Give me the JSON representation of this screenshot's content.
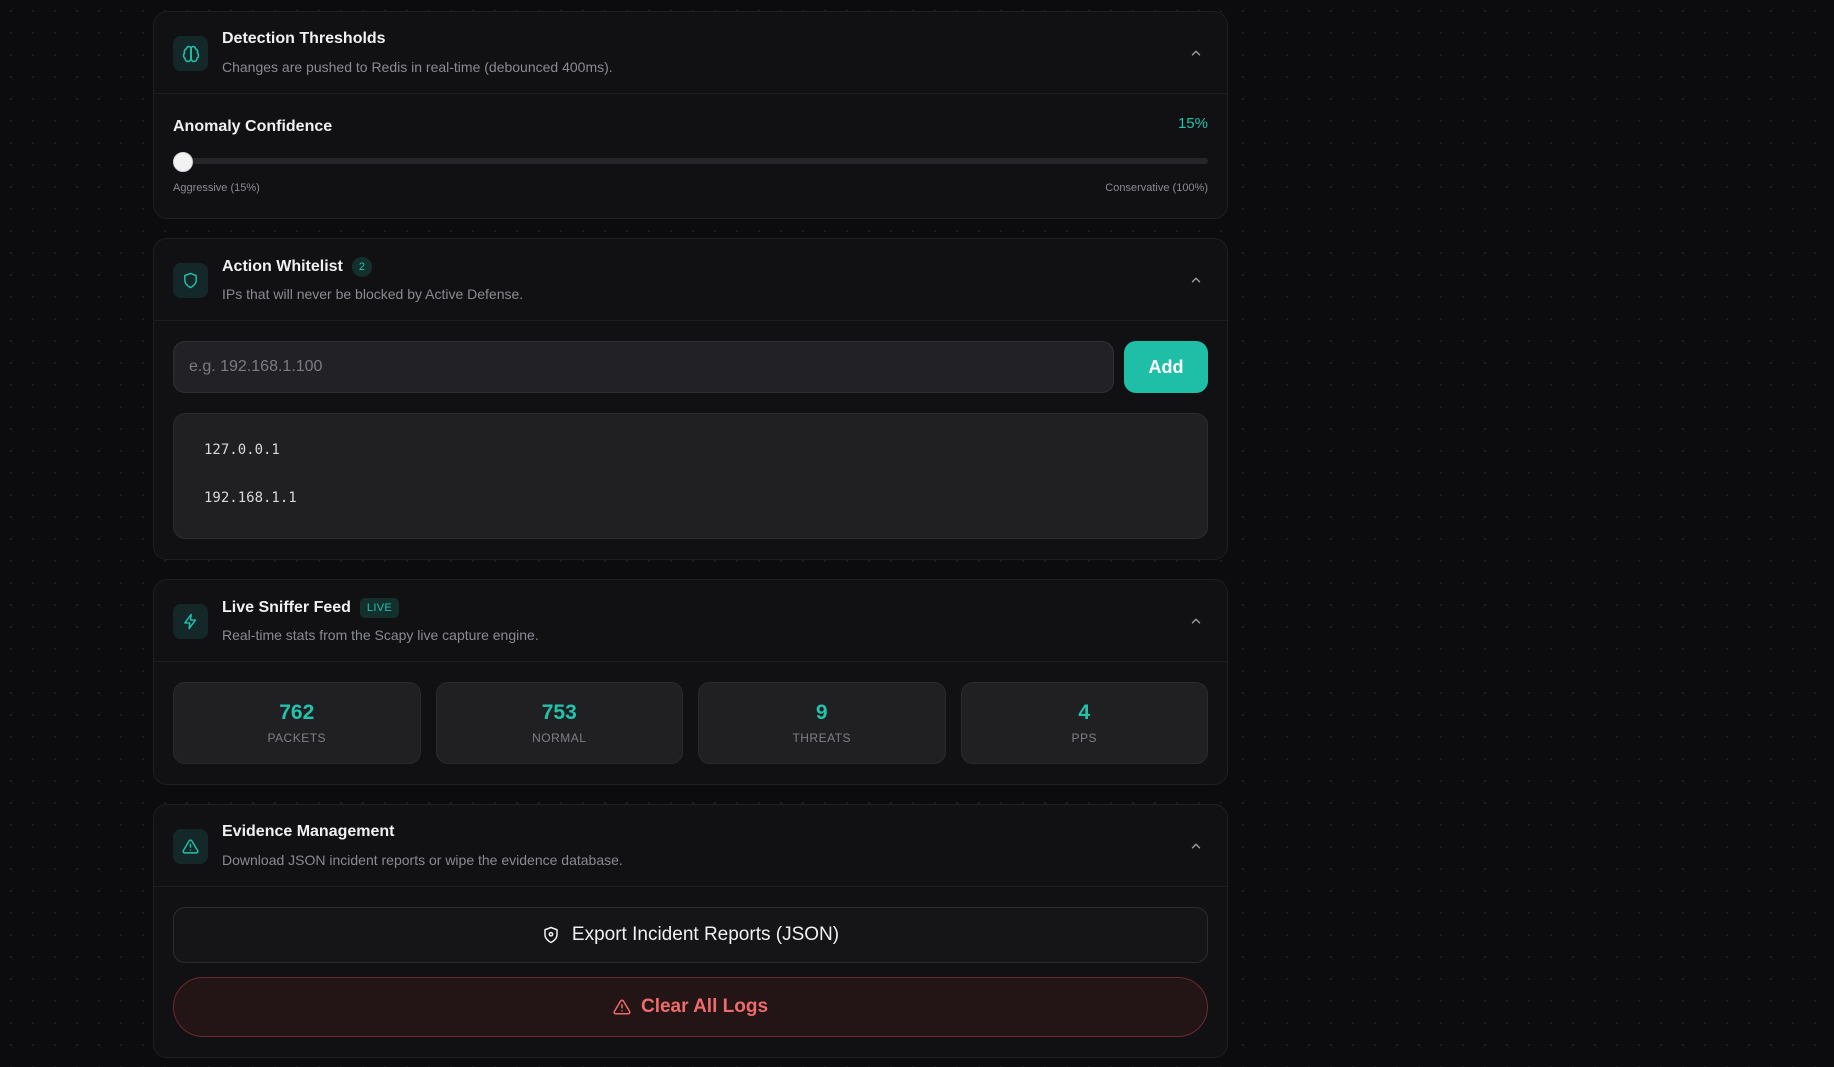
{
  "detection": {
    "title": "Detection Thresholds",
    "description": "Changes are pushed to Redis in real-time (debounced 400ms).",
    "slider_label": "Anomaly Confidence",
    "value_text": "15%",
    "value_fraction": 0.0,
    "range_min_label": "Aggressive (15%)",
    "range_max_label": "Conservative (100%)"
  },
  "whitelist": {
    "title": "Action Whitelist",
    "count": "2",
    "description": "IPs that will never be blocked by Active Defense.",
    "input_placeholder": "e.g. 192.168.1.100",
    "add_label": "Add",
    "entries": [
      "127.0.0.1",
      "192.168.1.1"
    ]
  },
  "sniffer": {
    "title": "Live Sniffer Feed",
    "badge": "LIVE",
    "description": "Real-time stats from the Scapy live capture engine.",
    "stats": [
      {
        "value": "762",
        "label": "PACKETS"
      },
      {
        "value": "753",
        "label": "NORMAL"
      },
      {
        "value": "9",
        "label": "THREATS"
      },
      {
        "value": "4",
        "label": "PPS"
      }
    ]
  },
  "evidence": {
    "title": "Evidence Management",
    "description": "Download JSON incident reports or wipe the evidence database.",
    "export_label": "Export Incident Reports (JSON)",
    "clear_label": "Clear All Logs"
  },
  "icons": {
    "detection": "brain-icon",
    "whitelist": "shield-icon",
    "sniffer": "lightning-icon",
    "evidence": "warning-triangle-icon",
    "collapse": "chevron-up-icon"
  },
  "colors": {
    "accent": "#22c3ad",
    "danger": "#ef6b6b",
    "background": "#0c0c0f",
    "card": "#111114"
  }
}
